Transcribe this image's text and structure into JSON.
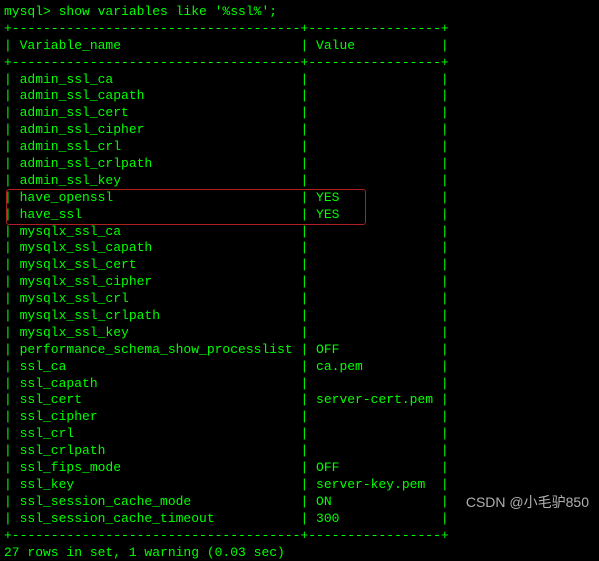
{
  "prompt": "mysql> show variables like '%ssl%';",
  "divider_top": "+-------------------------------------+-----------------+",
  "header": {
    "col1": "Variable_name",
    "col2": "Value"
  },
  "rows": [
    {
      "name": "admin_ssl_ca",
      "value": ""
    },
    {
      "name": "admin_ssl_capath",
      "value": ""
    },
    {
      "name": "admin_ssl_cert",
      "value": ""
    },
    {
      "name": "admin_ssl_cipher",
      "value": ""
    },
    {
      "name": "admin_ssl_crl",
      "value": ""
    },
    {
      "name": "admin_ssl_crlpath",
      "value": ""
    },
    {
      "name": "admin_ssl_key",
      "value": ""
    },
    {
      "name": "have_openssl",
      "value": "YES"
    },
    {
      "name": "have_ssl",
      "value": "YES"
    },
    {
      "name": "mysqlx_ssl_ca",
      "value": ""
    },
    {
      "name": "mysqlx_ssl_capath",
      "value": ""
    },
    {
      "name": "mysqlx_ssl_cert",
      "value": ""
    },
    {
      "name": "mysqlx_ssl_cipher",
      "value": ""
    },
    {
      "name": "mysqlx_ssl_crl",
      "value": ""
    },
    {
      "name": "mysqlx_ssl_crlpath",
      "value": ""
    },
    {
      "name": "mysqlx_ssl_key",
      "value": ""
    },
    {
      "name": "performance_schema_show_processlist",
      "value": "OFF"
    },
    {
      "name": "ssl_ca",
      "value": "ca.pem"
    },
    {
      "name": "ssl_capath",
      "value": ""
    },
    {
      "name": "ssl_cert",
      "value": "server-cert.pem"
    },
    {
      "name": "ssl_cipher",
      "value": ""
    },
    {
      "name": "ssl_crl",
      "value": ""
    },
    {
      "name": "ssl_crlpath",
      "value": ""
    },
    {
      "name": "ssl_fips_mode",
      "value": "OFF"
    },
    {
      "name": "ssl_key",
      "value": "server-key.pem"
    },
    {
      "name": "ssl_session_cache_mode",
      "value": "ON"
    },
    {
      "name": "ssl_session_cache_timeout",
      "value": "300"
    }
  ],
  "footer": "27 rows in set, 1 warning (0.03 sec)",
  "watermark": "CSDN @小毛驴850",
  "highlight_indices": [
    7,
    8
  ],
  "col1_width": 37,
  "col2_width": 17
}
